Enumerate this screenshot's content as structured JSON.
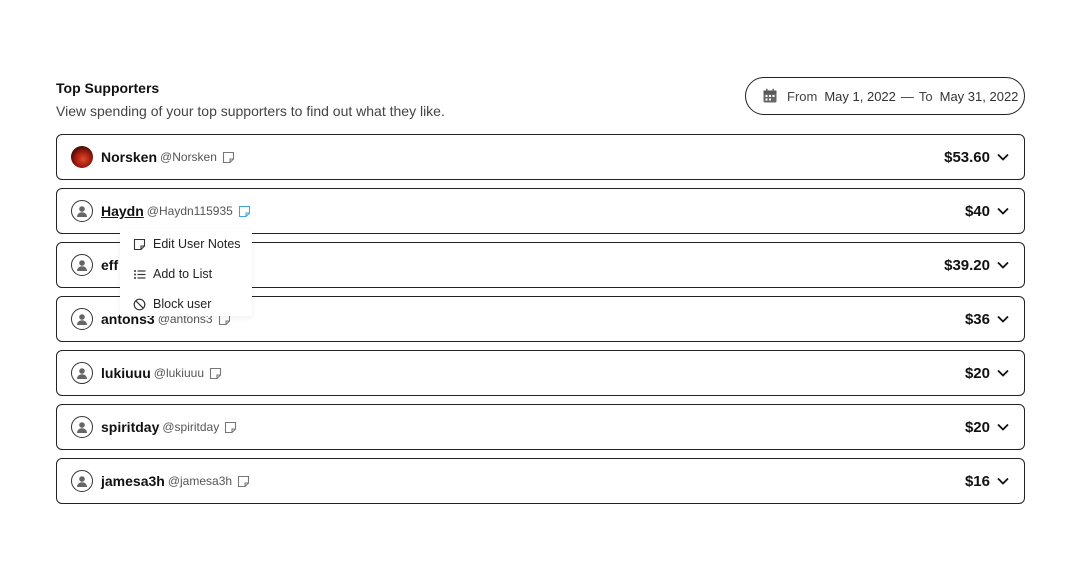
{
  "header": {
    "title": "Top Supporters",
    "subtitle": "View spending of your top supporters to find out what they like."
  },
  "date_range": {
    "from_label": "From",
    "from_value": "May 1, 2022",
    "separator": "—",
    "to_label": "To",
    "to_value": "May 31, 2022"
  },
  "supporters": [
    {
      "name": "Norsken",
      "handle": "@Norsken",
      "amount": "$53.60"
    },
    {
      "name": "Haydn",
      "handle": "@Haydn115935",
      "amount": "$40"
    },
    {
      "name": "eff",
      "handle": "",
      "amount": "$39.20"
    },
    {
      "name": "antons3",
      "handle": "@antons3",
      "amount": "$36"
    },
    {
      "name": "lukiuuu",
      "handle": "@lukiuuu",
      "amount": "$20"
    },
    {
      "name": "spiritday",
      "handle": "@spiritday",
      "amount": "$20"
    },
    {
      "name": "jamesa3h",
      "handle": "@jamesa3h",
      "amount": "$16"
    }
  ],
  "context_menu": {
    "items": [
      "Edit User Notes",
      "Add to List",
      "Block user"
    ]
  },
  "colors": {
    "border": "#222222",
    "note_icon_active": "#3da6e0"
  }
}
